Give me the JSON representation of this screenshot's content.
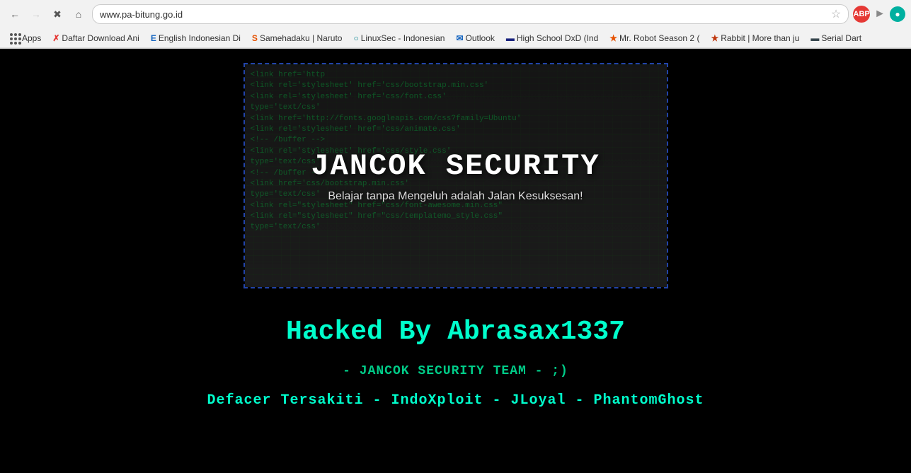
{
  "browser": {
    "url": "www.pa-bitung.go.id",
    "back_disabled": false,
    "forward_disabled": true,
    "profile_initials": "ABP",
    "bookmarks": [
      {
        "id": "apps",
        "label": "Apps",
        "icon": "grid"
      },
      {
        "id": "daftar",
        "label": "Daftar Download Ani",
        "icon": "K"
      },
      {
        "id": "english",
        "label": "English Indonesian Di",
        "icon": "E"
      },
      {
        "id": "samehadaku",
        "label": "Samehadaku | Naruto",
        "icon": "S"
      },
      {
        "id": "linuxsec",
        "label": "LinuxSec - Indonesian",
        "icon": "L"
      },
      {
        "id": "outlook",
        "label": "Outlook",
        "icon": "O"
      },
      {
        "id": "highschool",
        "label": "High School DxD (Ind",
        "icon": "B"
      },
      {
        "id": "mrrobot",
        "label": "Mr. Robot Season 2 (",
        "icon": "M"
      },
      {
        "id": "rabbit",
        "label": "Rabbit | More than ju",
        "icon": "R"
      },
      {
        "id": "serialdart",
        "label": "Serial Dart",
        "icon": "S2"
      }
    ]
  },
  "page": {
    "banner": {
      "title": "JANCOK SECURITY",
      "subtitle": "Belajar tanpa Mengeluh adalah Jalan Kesuksesan!",
      "code_lines": [
        "<link href='http",
        "<link rel='stylesheet' href='css/",
        "<link rel='stylesheet' href='css/bootstrap",
        "<!-- buffer -->",
        "<link rel='stylesheet' href='css/",
        "type='text/css'",
        "<!-- /buffer -->",
        "<link rel='stylesheet' href='css/",
        "type='text/css'",
        "<!-- /buffer -->"
      ]
    },
    "hack_title": "Hacked By Abrasax1337",
    "team_line": "- JANCOK SECURITY TEAM - ;)",
    "members_line": "Defacer Tersakiti - IndoXploit - JLoyal - PhantomGhost",
    "accent_color": "#00ffcc",
    "team_color": "#00cc88"
  }
}
